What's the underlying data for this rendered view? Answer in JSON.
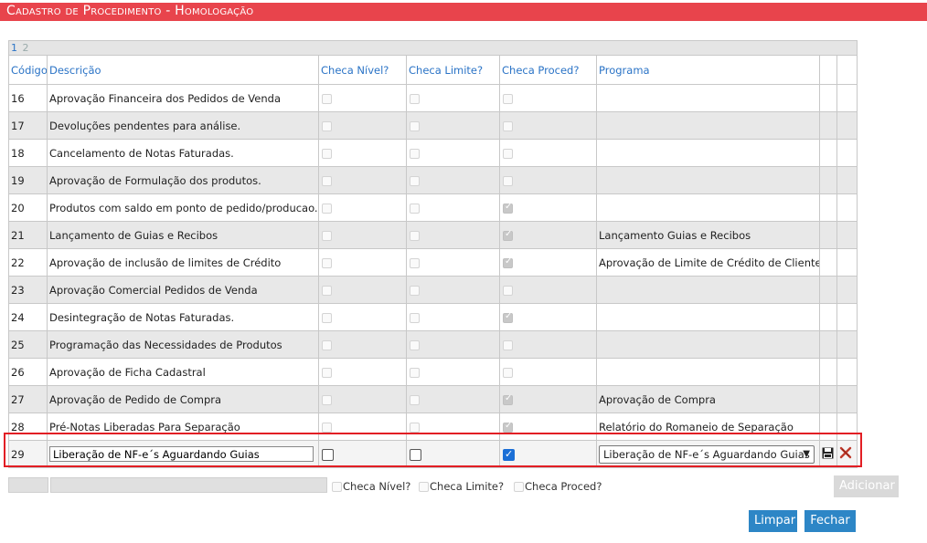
{
  "title": "Cadastro de Procedimento  - Homologação",
  "pager": [
    "1",
    "2"
  ],
  "columns": {
    "codigo": "Código",
    "descricao": "Descrição",
    "checa_nivel": "Checa Nível?",
    "checa_limite": "Checa Limite?",
    "checa_proced": "Checa Proced?",
    "programa": "Programa"
  },
  "rows": [
    {
      "codigo": "16",
      "descricao": "Aprovação Financeira dos Pedidos de Venda",
      "nivel": false,
      "limite": false,
      "proced": false,
      "programa": ""
    },
    {
      "codigo": "17",
      "descricao": "Devoluções pendentes para análise.",
      "nivel": false,
      "limite": false,
      "proced": false,
      "programa": ""
    },
    {
      "codigo": "18",
      "descricao": "Cancelamento de Notas Faturadas.",
      "nivel": false,
      "limite": false,
      "proced": false,
      "programa": ""
    },
    {
      "codigo": "19",
      "descricao": "Aprovação de Formulação dos produtos.",
      "nivel": false,
      "limite": false,
      "proced": false,
      "programa": ""
    },
    {
      "codigo": "20",
      "descricao": "Produtos com saldo em ponto de pedido/producao.",
      "nivel": false,
      "limite": false,
      "proced": true,
      "programa": ""
    },
    {
      "codigo": "21",
      "descricao": "Lançamento de Guias e Recibos",
      "nivel": false,
      "limite": false,
      "proced": true,
      "programa": "Lançamento Guias e Recibos"
    },
    {
      "codigo": "22",
      "descricao": "Aprovação de inclusão de limites de Crédito",
      "nivel": false,
      "limite": false,
      "proced": true,
      "programa": "Aprovação de Limite de Crédito de Clientes"
    },
    {
      "codigo": "23",
      "descricao": "Aprovação Comercial Pedidos de Venda",
      "nivel": false,
      "limite": false,
      "proced": false,
      "programa": ""
    },
    {
      "codigo": "24",
      "descricao": "Desintegração de Notas Faturadas.",
      "nivel": false,
      "limite": false,
      "proced": true,
      "programa": ""
    },
    {
      "codigo": "25",
      "descricao": "Programação das Necessidades de Produtos",
      "nivel": false,
      "limite": false,
      "proced": false,
      "programa": ""
    },
    {
      "codigo": "26",
      "descricao": "Aprovação de Ficha Cadastral",
      "nivel": false,
      "limite": false,
      "proced": false,
      "programa": ""
    },
    {
      "codigo": "27",
      "descricao": "Aprovação de Pedido de Compra",
      "nivel": false,
      "limite": false,
      "proced": true,
      "programa": "Aprovação de Compra"
    },
    {
      "codigo": "28",
      "descricao": "Pré-Notas Liberadas Para Separação",
      "nivel": false,
      "limite": false,
      "proced": true,
      "programa": "Relatório do Romaneio de Separação"
    }
  ],
  "edit_row": {
    "codigo": "29",
    "descricao": "Liberação de NF-e´s Aguardando Guias",
    "nivel": false,
    "limite": false,
    "proced": true,
    "programa": "Liberação de NF-e´s Aguardando Guias",
    "save_icon": "floppy-disk-icon",
    "cancel_icon": "x-delete-icon"
  },
  "new_row": {
    "nivel_label": "Checa Nível?",
    "limite_label": "Checa Limite?",
    "proced_label": "Checa Proced?",
    "add_label": "Adicionar"
  },
  "buttons": {
    "limpar": "Limpar",
    "fechar": "Fechar"
  },
  "colors": {
    "title_bar": "#e8444c",
    "header_text": "#2a73c6",
    "button_blue": "#2d86c6",
    "highlight": "#e21e24"
  }
}
